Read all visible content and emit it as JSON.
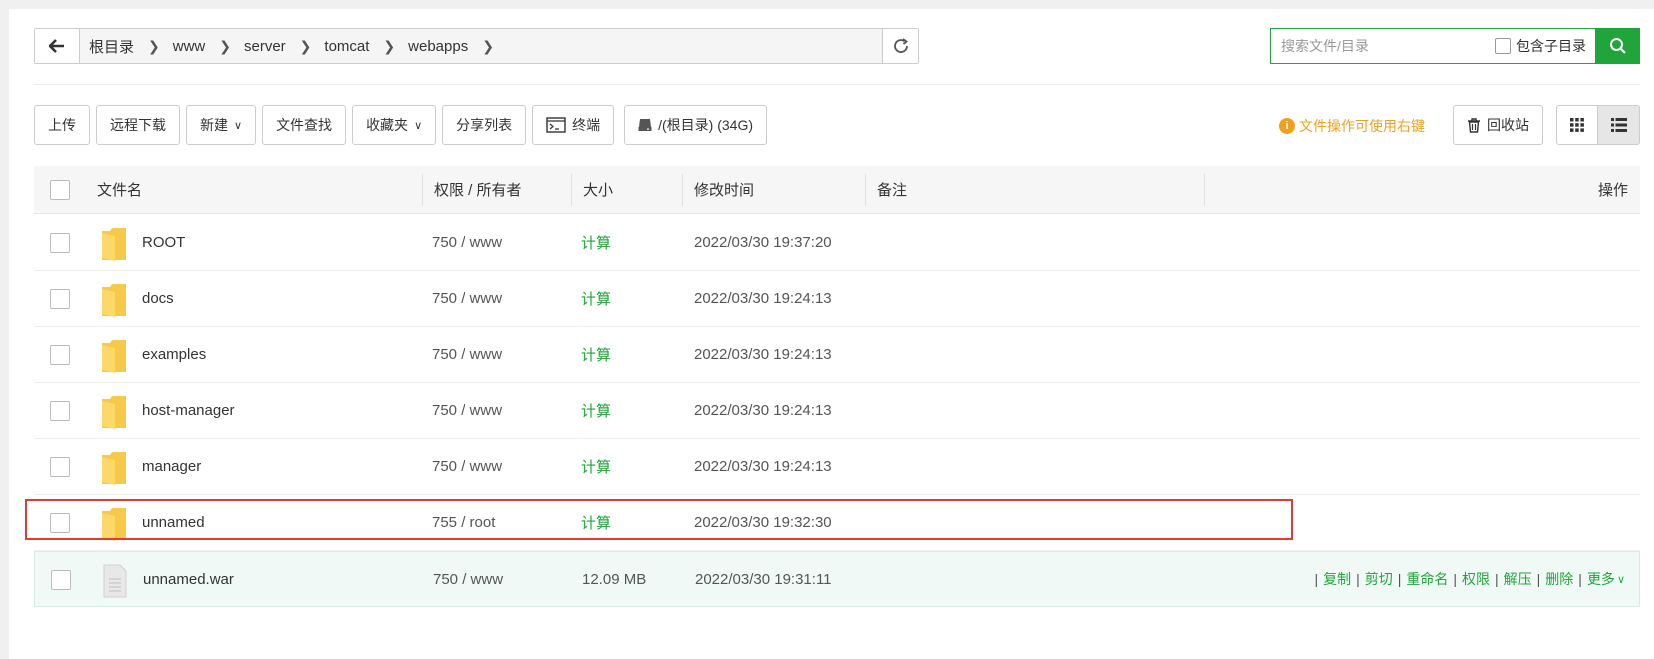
{
  "breadcrumb": [
    "根目录",
    "www",
    "server",
    "tomcat",
    "webapps"
  ],
  "search": {
    "placeholder": "搜索文件/目录",
    "include_sub_label": "包含子目录"
  },
  "toolbar": {
    "upload": "上传",
    "remote_download": "远程下载",
    "new": "新建",
    "file_search": "文件查找",
    "favorites": "收藏夹",
    "share_list": "分享列表",
    "terminal": "终端",
    "disk": "/(根目录) (34G)"
  },
  "tip": "文件操作可使用右键",
  "recycle": "回收站",
  "table": {
    "headers": {
      "name": "文件名",
      "perm": "权限 / 所有者",
      "size": "大小",
      "mtime": "修改时间",
      "note": "备注",
      "ops": "操作"
    },
    "rows": [
      {
        "name": "ROOT",
        "perm": "750 / www",
        "size": "计算",
        "mtime": "2022/03/30 19:37:20"
      },
      {
        "name": "docs",
        "perm": "750 / www",
        "size": "计算",
        "mtime": "2022/03/30 19:24:13"
      },
      {
        "name": "examples",
        "perm": "750 / www",
        "size": "计算",
        "mtime": "2022/03/30 19:24:13"
      },
      {
        "name": "host-manager",
        "perm": "750 / www",
        "size": "计算",
        "mtime": "2022/03/30 19:24:13"
      },
      {
        "name": "manager",
        "perm": "750 / www",
        "size": "计算",
        "mtime": "2022/03/30 19:24:13"
      },
      {
        "name": "unnamed",
        "perm": "755 / root",
        "size": "计算",
        "mtime": "2022/03/30 19:32:30"
      },
      {
        "name": "unnamed.war",
        "perm": "750 / www",
        "size": "12.09 MB",
        "mtime": "2022/03/30 19:31:11"
      }
    ],
    "row_ops": [
      "复制",
      "剪切",
      "重命名",
      "权限",
      "解压",
      "删除",
      "更多"
    ]
  },
  "colors": {
    "accent": "#20a53a",
    "tip": "#f0a020",
    "highlight_border": "#e53935",
    "folder": "#f7c948"
  }
}
